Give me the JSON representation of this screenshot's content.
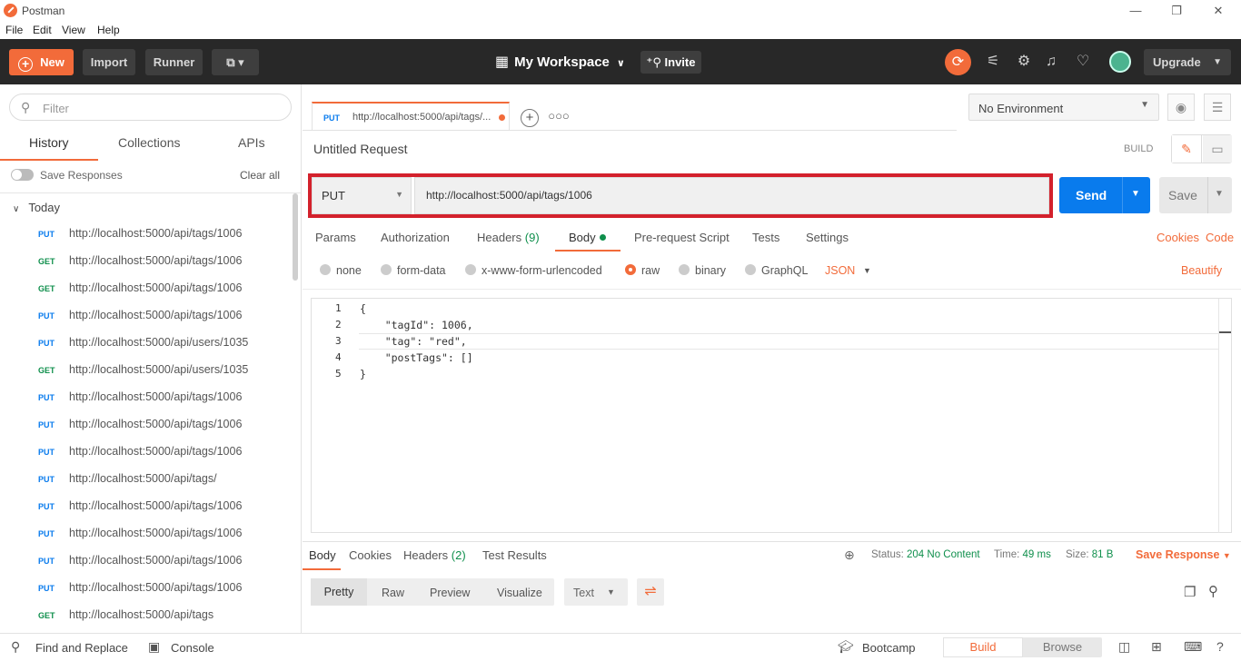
{
  "window": {
    "title": "Postman",
    "minimize": "—",
    "restore": "❐",
    "close": "✕"
  },
  "menu": [
    "File",
    "Edit",
    "View",
    "Help"
  ],
  "header": {
    "new_label": "New",
    "import_label": "Import",
    "runner_label": "Runner",
    "workspace_label": "My Workspace",
    "invite_label": "Invite",
    "upgrade_label": "Upgrade"
  },
  "sidebar": {
    "filter_placeholder": "Filter",
    "tabs": [
      "History",
      "Collections",
      "APIs"
    ],
    "save_responses_label": "Save Responses",
    "clear_all_label": "Clear all",
    "group_label": "Today",
    "history": [
      {
        "method": "PUT",
        "url": "http://localhost:5000/api/tags/1006"
      },
      {
        "method": "GET",
        "url": "http://localhost:5000/api/tags/1006"
      },
      {
        "method": "GET",
        "url": "http://localhost:5000/api/tags/1006"
      },
      {
        "method": "PUT",
        "url": "http://localhost:5000/api/tags/1006"
      },
      {
        "method": "PUT",
        "url": "http://localhost:5000/api/users/1035"
      },
      {
        "method": "GET",
        "url": "http://localhost:5000/api/users/1035"
      },
      {
        "method": "PUT",
        "url": "http://localhost:5000/api/tags/1006"
      },
      {
        "method": "PUT",
        "url": "http://localhost:5000/api/tags/1006"
      },
      {
        "method": "PUT",
        "url": "http://localhost:5000/api/tags/1006"
      },
      {
        "method": "PUT",
        "url": "http://localhost:5000/api/tags/"
      },
      {
        "method": "PUT",
        "url": "http://localhost:5000/api/tags/1006"
      },
      {
        "method": "PUT",
        "url": "http://localhost:5000/api/tags/1006"
      },
      {
        "method": "PUT",
        "url": "http://localhost:5000/api/tags/1006"
      },
      {
        "method": "PUT",
        "url": "http://localhost:5000/api/tags/1006"
      },
      {
        "method": "GET",
        "url": "http://localhost:5000/api/tags"
      }
    ]
  },
  "request_tab": {
    "method": "PUT",
    "url": "http://localhost:5000/api/tags/..."
  },
  "environment": {
    "selected": "No Environment"
  },
  "request": {
    "name": "Untitled Request",
    "build_label": "BUILD",
    "method": "PUT",
    "url": "http://localhost:5000/api/tags/1006",
    "send_label": "Send",
    "save_label": "Save",
    "tabs": {
      "params": "Params",
      "authorization": "Authorization",
      "headers": "Headers",
      "headers_count": "(9)",
      "body": "Body",
      "prerequest": "Pre-request Script",
      "tests": "Tests",
      "settings": "Settings"
    },
    "cookies_label": "Cookies",
    "code_label": "Code",
    "body_types": [
      "none",
      "form-data",
      "x-www-form-urlencoded",
      "raw",
      "binary",
      "GraphQL"
    ],
    "body_type_selected": "raw",
    "format": "JSON",
    "beautify_label": "Beautify",
    "code_lines": [
      "{",
      "    \"tagId\": 1006,",
      "    \"tag\": \"red\",",
      "    \"postTags\": []",
      "}"
    ],
    "line_numbers": [
      "1",
      "2",
      "3",
      "4",
      "5"
    ]
  },
  "response": {
    "tabs": {
      "body": "Body",
      "cookies": "Cookies",
      "headers": "Headers",
      "headers_count": "(2)",
      "test_results": "Test Results"
    },
    "status_label": "Status:",
    "status_value": "204 No Content",
    "time_label": "Time:",
    "time_value": "49 ms",
    "size_label": "Size:",
    "size_value": "81 B",
    "save_response_label": "Save Response",
    "views": [
      "Pretty",
      "Raw",
      "Preview",
      "Visualize"
    ],
    "text_format": "Text"
  },
  "statusbar": {
    "find_replace": "Find and Replace",
    "console": "Console",
    "bootcamp": "Bootcamp",
    "build": "Build",
    "browse": "Browse"
  },
  "colors": {
    "accent": "#f26b3a",
    "send": "#097bed",
    "put": "#097bed",
    "get": "#0f8f4c",
    "highlight": "#d3212c"
  }
}
